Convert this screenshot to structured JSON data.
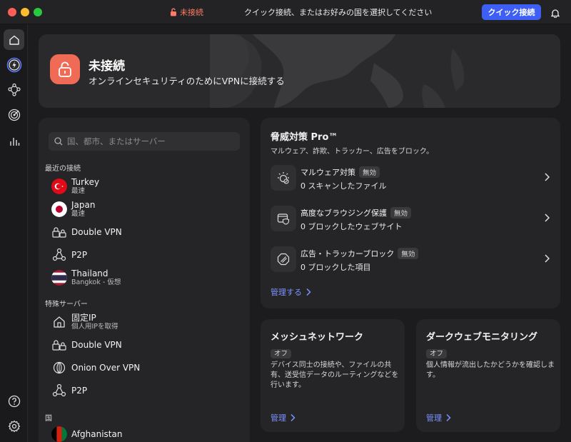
{
  "titlebar": {
    "status": "未接続",
    "title": "クイック接続、またはお好みの国を選択してください",
    "quick_connect": "クイック接続"
  },
  "hero": {
    "title": "未接続",
    "subtitle": "オンラインセキュリティのためにVPNに接続する"
  },
  "search": {
    "placeholder": "国、都市、またはサーバー"
  },
  "recent": {
    "heading": "最近の接続",
    "items": [
      {
        "title": "Turkey",
        "sub": "最速",
        "icon": "turkey-flag"
      },
      {
        "title": "Japan",
        "sub": "最速",
        "icon": "japan-flag"
      },
      {
        "title": "Double VPN",
        "icon": "double-lock-icon"
      },
      {
        "title": "P2P",
        "icon": "p2p-icon"
      },
      {
        "title": "Thailand",
        "sub": "Bangkok - 仮想",
        "icon": "thailand-flag"
      }
    ]
  },
  "special": {
    "heading": "特殊サーバー",
    "items": [
      {
        "title": "固定IP",
        "sub": "個人用IPを取得",
        "icon": "house-icon"
      },
      {
        "title": "Double VPN",
        "icon": "double-lock-icon"
      },
      {
        "title": "Onion Over VPN",
        "icon": "onion-icon"
      },
      {
        "title": "P2P",
        "icon": "p2p-icon"
      }
    ]
  },
  "countries": {
    "heading": "国",
    "first": "Afghanistan"
  },
  "threat": {
    "title": "脅威対策 Pro™",
    "subtitle": "マルウェア、詐欺、トラッカー、広告をブロック。",
    "rows": [
      {
        "name": "マルウェア対策",
        "badge": "無効",
        "count": "0 スキャンしたファイル"
      },
      {
        "name": "高度なブラウジング保護",
        "badge": "無効",
        "count": "0 ブロックしたウェブサイト"
      },
      {
        "name": "広告・トラッカーブロック",
        "badge": "無効",
        "count": "0 ブロックした項目"
      }
    ],
    "manage": "管理する"
  },
  "mesh": {
    "title": "メッシュネットワーク",
    "badge": "オフ",
    "desc": "デバイス同士の接続や、ファイルの共有、送受信データのルーティングなどを行います。",
    "manage": "管理"
  },
  "darkweb": {
    "title": "ダークウェブモニタリング",
    "badge": "オフ",
    "desc": "個人情報が流出したかどうかを確認します。",
    "manage": "管理"
  },
  "colors": {
    "accent": "#3e5ff5",
    "link": "#7b93ff",
    "danger": "#f06b56"
  }
}
